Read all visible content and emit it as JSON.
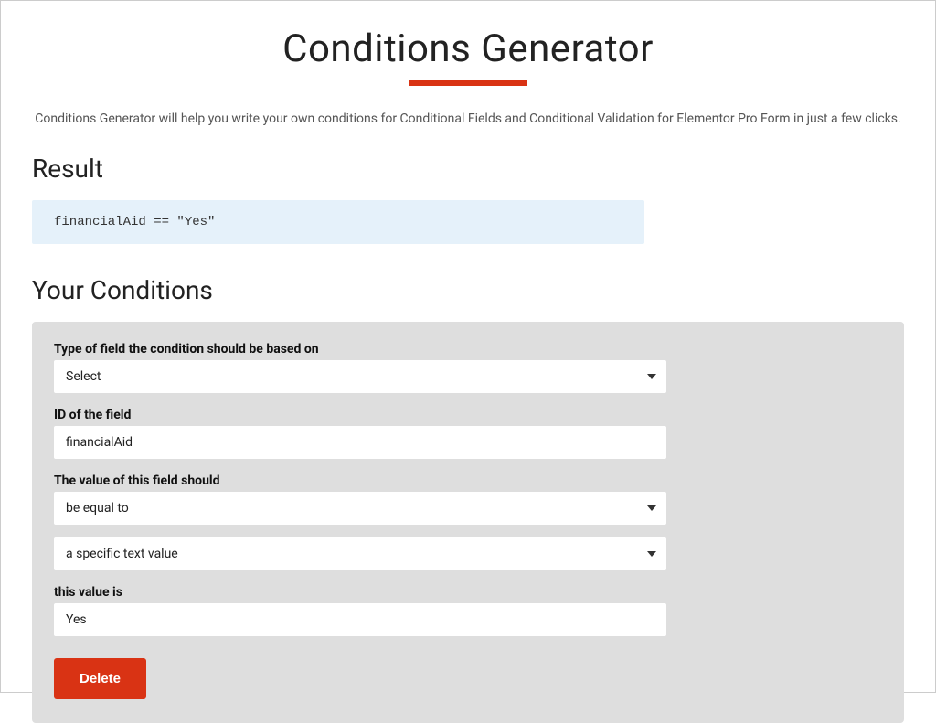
{
  "header": {
    "title": "Conditions Generator",
    "subtitle": "Conditions Generator will help you write your own conditions for Conditional Fields and Conditional Validation for Elementor Pro Form in just a few clicks."
  },
  "result": {
    "heading": "Result",
    "code": "financialAid == \"Yes\""
  },
  "conditions": {
    "heading": "Your Conditions",
    "labels": {
      "fieldType": "Type of field the condition should be based on",
      "fieldId": "ID of the field",
      "valueShould": "The value of this field should",
      "thisValue": "this value is"
    },
    "values": {
      "fieldTypeSelected": "Select",
      "fieldId": "financialAid",
      "operator": "be equal to",
      "valueType": "a specific text value",
      "value": "Yes"
    },
    "deleteLabel": "Delete"
  }
}
